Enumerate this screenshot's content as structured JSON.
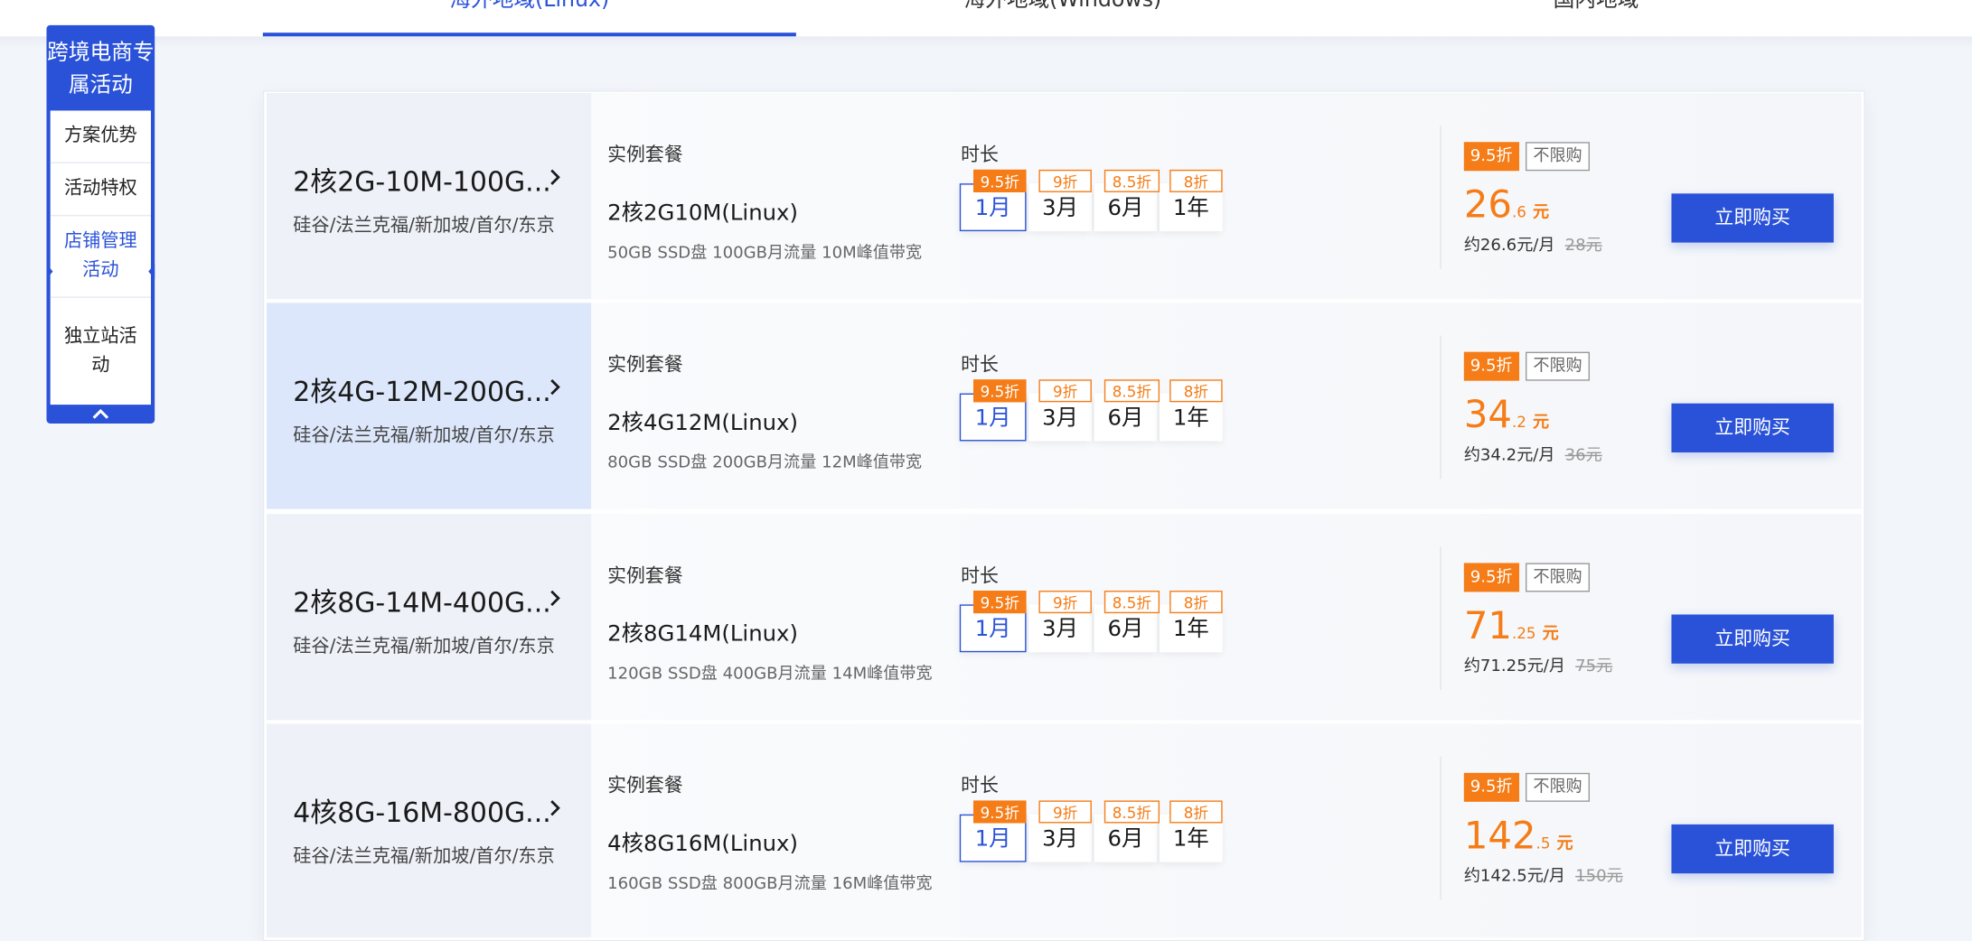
{
  "tabs": [
    {
      "label": "海外地域(Linux)",
      "active": true
    },
    {
      "label": "海外地域(Windows)",
      "active": false
    },
    {
      "label": "国内地域",
      "active": false
    }
  ],
  "sidebar": {
    "title": "跨境电商专属活动",
    "items": [
      {
        "label": "方案优势",
        "active": false
      },
      {
        "label": "活动特权",
        "active": false
      },
      {
        "label": "店铺管理活动",
        "active": true
      },
      {
        "label": "独立站活动",
        "active": false
      }
    ],
    "collapse_icon": "chevron-up-icon"
  },
  "labels": {
    "package": "实例套餐",
    "duration": "时长",
    "discount": "9.5折",
    "limit": "不限购",
    "buy": "立即购买"
  },
  "durations": [
    {
      "label": "1月",
      "badge": "9.5折",
      "selected": true
    },
    {
      "label": "3月",
      "badge": "9折",
      "selected": false
    },
    {
      "label": "6月",
      "badge": "8.5折",
      "selected": false
    },
    {
      "label": "1年",
      "badge": "8折",
      "selected": false
    }
  ],
  "rows": [
    {
      "name": "2核2G-10M-100G...",
      "regions": "硅谷/法兰克福/新加坡/首尔/东京",
      "package": "2核2G10M(Linux)",
      "spec": "50GB SSD盘 100GB月流量 10M峰值带宽",
      "price_int": "26",
      "price_dec": ".6",
      "price_unit": "元",
      "monthly": "约26.6元/月",
      "original": "28元",
      "highlight": false
    },
    {
      "name": "2核4G-12M-200G...",
      "regions": "硅谷/法兰克福/新加坡/首尔/东京",
      "package": "2核4G12M(Linux)",
      "spec": "80GB SSD盘 200GB月流量 12M峰值带宽",
      "price_int": "34",
      "price_dec": ".2",
      "price_unit": "元",
      "monthly": "约34.2元/月",
      "original": "36元",
      "highlight": true
    },
    {
      "name": "2核8G-14M-400G...",
      "regions": "硅谷/法兰克福/新加坡/首尔/东京",
      "package": "2核8G14M(Linux)",
      "spec": "120GB SSD盘 400GB月流量 14M峰值带宽",
      "price_int": "71",
      "price_dec": ".25",
      "price_unit": "元",
      "monthly": "约71.25元/月",
      "original": "75元",
      "highlight": false
    },
    {
      "name": "4核8G-16M-800G...",
      "regions": "硅谷/法兰克福/新加坡/首尔/东京",
      "package": "4核8G16M(Linux)",
      "spec": "160GB SSD盘 800GB月流量 16M峰值带宽",
      "price_int": "142",
      "price_dec": ".5",
      "price_unit": "元",
      "monthly": "约142.5元/月",
      "original": "150元",
      "highlight": false
    }
  ],
  "colors": {
    "accent": "#2a52d8",
    "orange": "#f57c16"
  }
}
